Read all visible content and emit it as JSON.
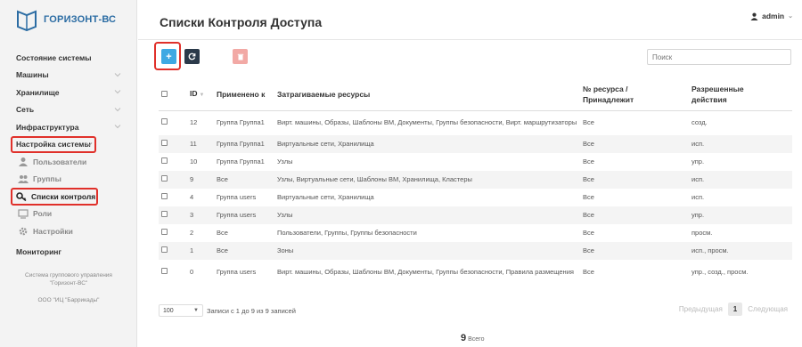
{
  "brand": {
    "name": "ГОРИЗОНТ-ВС"
  },
  "sidebar": {
    "items": [
      {
        "label": "Состояние системы",
        "chevron": false
      },
      {
        "label": "Машины",
        "chevron": true
      },
      {
        "label": "Хранилище",
        "chevron": true
      },
      {
        "label": "Сеть",
        "chevron": true
      },
      {
        "label": "Инфраструктура",
        "chevron": true
      },
      {
        "label": "Настройка системы",
        "chevron": true
      }
    ],
    "sub_items": [
      {
        "label": "Пользователи",
        "icon": "users-icon"
      },
      {
        "label": "Группы",
        "icon": "groups-icon"
      },
      {
        "label": "Списки контроля",
        "icon": "key-icon"
      },
      {
        "label": "Роли",
        "icon": "monitor-icon"
      },
      {
        "label": "Настройки",
        "icon": "gear-icon"
      }
    ],
    "monitoring": "Мониторинг",
    "footer_line1": "Система группового управления",
    "footer_line2": "\"Горизонт-ВС\"",
    "footer_line3": "ООО \"ИЦ \"Баррикады\""
  },
  "header": {
    "title": "Списки Контроля Доступа",
    "user": "admin"
  },
  "toolbar": {
    "add_label": "+",
    "search_placeholder": "Поиск"
  },
  "table": {
    "columns": [
      "ID",
      "Применено к",
      "Затрагиваемые ресурсы",
      "№ ресурса / Принадлежит",
      "Разрешенные действия"
    ],
    "rows": [
      {
        "id": "12",
        "applies": "Группа Группа1",
        "resources": "Вирт. машины, Образы, Шаблоны ВМ, Документы, Группы безопасности, Вирт. маршрутизаторы",
        "owner": "Все",
        "actions": "созд."
      },
      {
        "id": "11",
        "applies": "Группа Группа1",
        "resources": "Виртуальные сети, Хранилища",
        "owner": "Все",
        "actions": "исп."
      },
      {
        "id": "10",
        "applies": "Группа Группа1",
        "resources": "Узлы",
        "owner": "Все",
        "actions": "упр."
      },
      {
        "id": "9",
        "applies": "Все",
        "resources": "Узлы, Виртуальные сети, Шаблоны ВМ, Хранилища, Кластеры",
        "owner": "Все",
        "actions": "исп."
      },
      {
        "id": "4",
        "applies": "Группа users",
        "resources": "Виртуальные сети, Хранилища",
        "owner": "Все",
        "actions": "исп."
      },
      {
        "id": "3",
        "applies": "Группа users",
        "resources": "Узлы",
        "owner": "Все",
        "actions": "упр."
      },
      {
        "id": "2",
        "applies": "Все",
        "resources": "Пользователи, Группы, Группы безопасности",
        "owner": "Все",
        "actions": "просм."
      },
      {
        "id": "1",
        "applies": "Все",
        "resources": "Зоны",
        "owner": "Все",
        "actions": "исп., просм."
      },
      {
        "id": "0",
        "applies": "Группа users",
        "resources": "Вирт. машины, Образы, Шаблоны ВМ, Документы, Группы безопасности, Правила размещения",
        "owner": "Все",
        "actions": "упр., созд., просм."
      }
    ]
  },
  "footer": {
    "page_length": "100",
    "info": "Записи с 1 до 9 из 9 записей",
    "prev": "Предыдущая",
    "page": "1",
    "next": "Следующая",
    "total_count": "9",
    "total_label": "Всего"
  }
}
